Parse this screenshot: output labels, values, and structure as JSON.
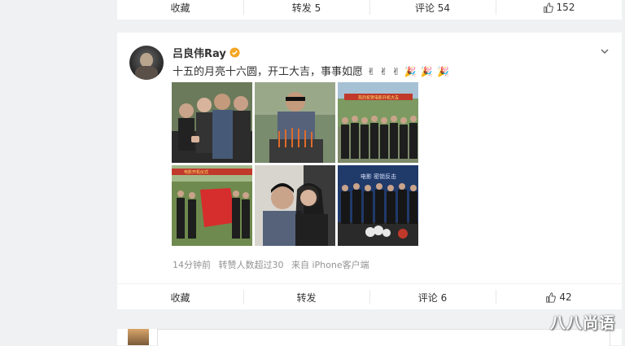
{
  "top_actions": {
    "favorite": "收藏",
    "repost": "转发 5",
    "comment": "评论 54",
    "like_count": "152"
  },
  "post": {
    "username": "吕良伟Ray",
    "text": "十五的月亮十六圆，开工大吉，事事如愿",
    "emojis": [
      "✌",
      "✌",
      "✌",
      "🎉",
      "🎉",
      "🎉"
    ],
    "meta": {
      "time": "14分钟前",
      "repost_info": "转赞人数超过30",
      "source": "来自 iPhone客户端"
    },
    "actions": {
      "favorite": "收藏",
      "repost": "转发",
      "comment": "评论 6",
      "like_count": "42"
    },
    "photo_captions": {
      "p3_banner": "热烈祝贺电影开机大吉",
      "p4_banner": "电影开机仪式",
      "p6_banner": "电影 密锁反击"
    }
  },
  "watermark": "八八尚语",
  "colors": {
    "accent_verified": "#f5a623",
    "text": "#333333",
    "meta": "#939393",
    "background": "#eff1f3"
  }
}
